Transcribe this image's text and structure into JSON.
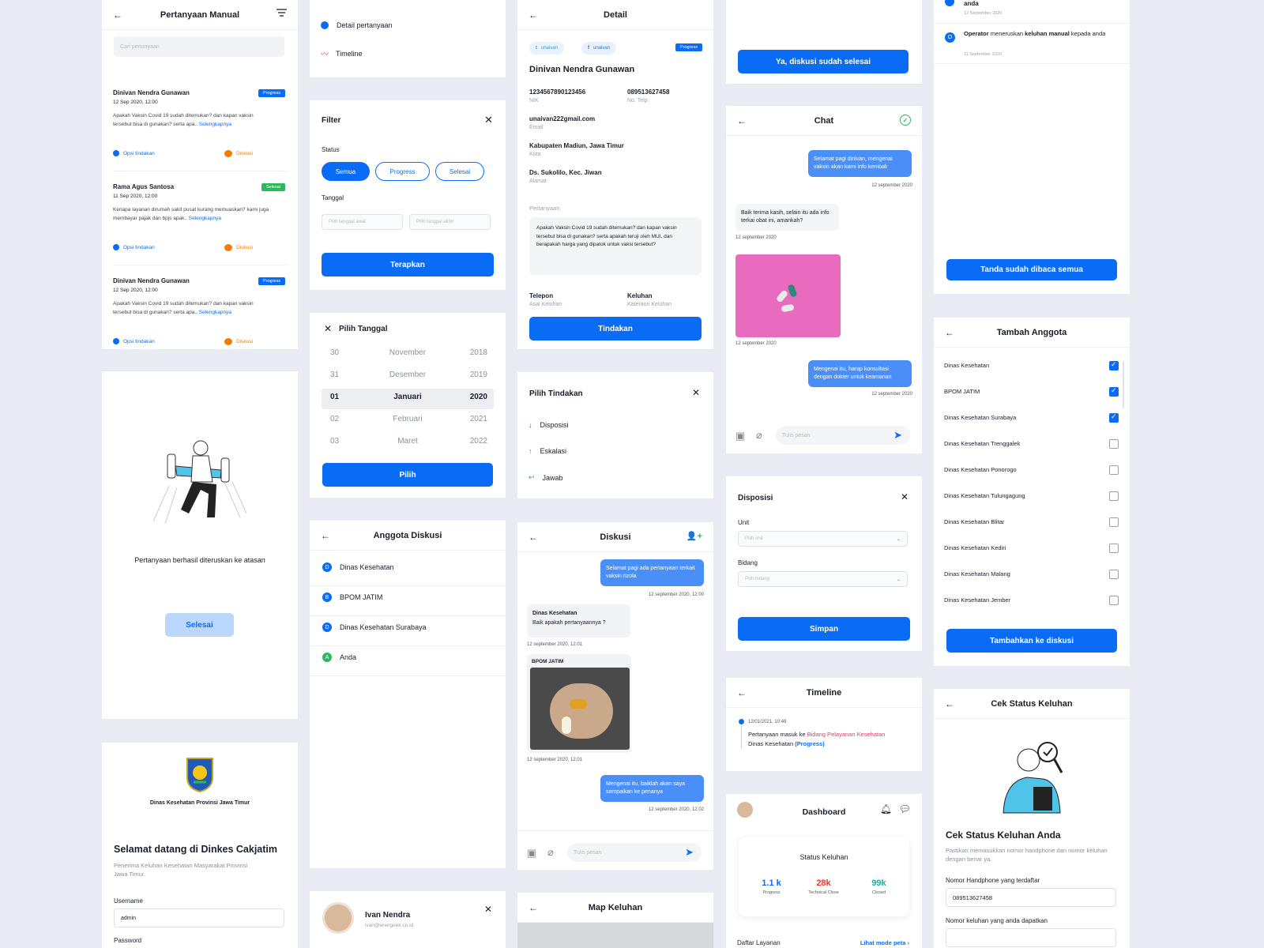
{
  "pertanyaan": {
    "title": "Pertanyaan Manual",
    "search_placeholder": "Cari pertanyaan",
    "items": [
      {
        "name": "Dinivan Nendra Gunawan",
        "date": "12 Sep 2020, 12:00",
        "badge": "Progress",
        "text": "Apakah Vaksin Covid 19 sudah ditemukan? dan kapan vaksin tersebut bisa di gunakan? serta apa..",
        "more": "Selengkapnya",
        "opsi": "Opsi tindakan",
        "diskusi": "Diskusi"
      },
      {
        "name": "Rama Agus Santosa",
        "date": "11 Sep 2020, 12:00",
        "badge": "Selesai",
        "text": "Kenapa layanan dirumah sakit pusat kurang memuaskan? kami juga membayar pajak dan bpjs apak..",
        "more": "Selengkapnya",
        "opsi": "Opsi tindakan",
        "diskusi": "Diskusi"
      },
      {
        "name": "Dinivan Nendra Gunawan",
        "date": "12 Sep 2020, 12:00",
        "badge": "Progress",
        "text": "Apakah Vaksin Covid 19 sudah ditemukan? dan kapan vaksin tersebut bisa di gunakan? serta apa..",
        "more": "Selengkapnya",
        "opsi": "Opsi tindakan",
        "diskusi": "Diskusi"
      }
    ]
  },
  "success": {
    "message": "Pertanyaan berhasil diteruskan ke atasan",
    "button": "Selesai"
  },
  "login": {
    "org": "Dinas Kesehatan Provinsi Jawa Timur",
    "welcome": "Selamat datang di Dinkes Cakjatim",
    "sub": "Penerima Keluhan Kesehatan Masyarakat Provinsi Jawa Timur.",
    "username_label": "Username",
    "username_value": "admin",
    "password_label": "Password"
  },
  "menu": {
    "item1": "Detail pertanyaan",
    "item2": "Timeline"
  },
  "filter": {
    "title": "Filter",
    "status_label": "Status",
    "statuses": [
      "Semua",
      "Progress",
      "Selesai"
    ],
    "tanggal_label": "Tanggal",
    "from_placeholder": "Pilih tanggal awal",
    "to_placeholder": "Pilih tanggal akhir",
    "apply": "Terapkan"
  },
  "picker": {
    "title": "Pilih Tanggal",
    "days": [
      "30",
      "31",
      "01",
      "02",
      "03"
    ],
    "months": [
      "November",
      "Desember",
      "Januari",
      "Februari",
      "Maret"
    ],
    "years": [
      "2018",
      "2019",
      "2020",
      "2021",
      "2022"
    ],
    "button": "Pilih"
  },
  "anggota": {
    "title": "Anggota Diskusi",
    "members": [
      {
        "initial": "D",
        "name": "Dinas Kesehatan",
        "color": "#0a6cf5"
      },
      {
        "initial": "B",
        "name": "BPOM JATIM",
        "color": "#0a6cf5"
      },
      {
        "initial": "D",
        "name": "Dinas Kesehatan Surabaya",
        "color": "#0a6cf5"
      },
      {
        "initial": "A",
        "name": "Anda",
        "color": "#2eb85c"
      }
    ]
  },
  "profile": {
    "name": "Ivan Nendra",
    "email": "ivan@energeek.co.id"
  },
  "detail": {
    "title": "Detail",
    "twitter": "unaivan",
    "facebook": "unaivan",
    "badge": "Progress",
    "name": "Dinivan Nendra Gunawan",
    "nik": "1234567890123456",
    "nik_label": "NIK",
    "phone": "089513627458",
    "phone_label": "No. Telp",
    "email": "unaivan222gmail.com",
    "email_label": "Email",
    "kota": "Kabupaten Madiun, Jawa Timur",
    "kota_label": "Kota",
    "alamat": "Ds. Sukolilo, Kec. Jiwan",
    "alamat_label": "Alamat",
    "q_label": "Pertanyaan",
    "question": "Apakah Vaksin Covid 19 sudah ditemukan? dan kapan vaksin tersebut bisa di gunakan? serta apakah teruji oleh MUI, dan berapakah harga yang dipatok untuk vaksi tersebut?",
    "telepon": "Telepon",
    "asal": "Asal Keluhan",
    "keluhan": "Keluhan",
    "kategori": "Kateraori Keluhan",
    "button": "Tindakan"
  },
  "tindakan": {
    "title": "Pilih Tindakan",
    "items": [
      "Disposisi",
      "Eskalasi",
      "Jawab"
    ]
  },
  "diskusi": {
    "title": "Diskusi",
    "m1": "Selamat pagi ada pertanyaan terkait vaksin rizola",
    "t1": "12 september 2020, 12:00",
    "s2": "Dinas Kesehatan",
    "m2": "Baik apakah pertanyaannya ?",
    "t2": "12 september 2020, 12:01",
    "s3": "BPOM JATIM",
    "t3": "12 september 2020, 12:01",
    "m4": "Mengenai itu, baiklah akan saya sampaikan ke penanya",
    "t4": "12 september 2020, 12:02",
    "input": "Tulis pesan"
  },
  "map": {
    "title": "Map Keluhan"
  },
  "confirm": {
    "button": "Ya, diskusi sudah selesai"
  },
  "chat": {
    "title": "Chat",
    "m1": "Selamat pagi dinivan, mengenai vaksin akan kami info kembali",
    "t1": "12 september 2020",
    "m2": "Baik terima kasih, selain itu ada info terkai obat ini, amankah?",
    "t2": "12 september 2020",
    "t3": "12 september 2020",
    "m4": "Mengenai itu, harap konsultasi dengan dokter untuk keamanan",
    "t4": "12 september 2020",
    "input": "Tulis pesan"
  },
  "disposisi": {
    "title": "Disposisi",
    "unit_label": "Unit",
    "unit_placeholder": "Pilih unit",
    "bidang_label": "Bidang",
    "bidang_placeholder": "Pilih bidang",
    "button": "Simpan"
  },
  "timeline": {
    "title": "Timeline",
    "date": "12/01/2021, 10:49",
    "pre": "Pertanyaan masuk ke ",
    "highlight": "Bidang Pelayanan Kesehatan",
    "org": "Dinas Kesehatan ",
    "status": "(Progress)"
  },
  "dashboard": {
    "title": "Dashboard",
    "status_title": "Status Keluhan",
    "stats": [
      {
        "value": "1.1 k",
        "label": "Progress",
        "color": "#0a6cf5"
      },
      {
        "value": "28k",
        "label": "Technical Close",
        "color": "#e53935"
      },
      {
        "value": "99k",
        "label": "Closed",
        "color": "#18b3a4"
      }
    ],
    "daftar": "Daftar Layanan",
    "lihat": "Lihat mode peta"
  },
  "notif": {
    "n0_text": "anda",
    "n0_date": "12 September 2020",
    "n1_bold": "Operator",
    "n1_pre": " meneruskan ",
    "n1_bold2": "keluhan manual",
    "n1_post": " kepada anda",
    "n1_date": "11 September 2020",
    "button": "Tanda sudah dibaca semua"
  },
  "tambah": {
    "title": "Tambah Anggota",
    "items": [
      {
        "name": "Dinas Kesehatan",
        "checked": true
      },
      {
        "name": "BPOM JATIM",
        "checked": true
      },
      {
        "name": "Dinas Kesehatan Surabaya",
        "checked": true
      },
      {
        "name": "Dinas Kesehatan Trenggalek",
        "checked": false
      },
      {
        "name": "Dinas Kesehatan Ponorogo",
        "checked": false
      },
      {
        "name": "Dinas Kesehatan Tulungagung",
        "checked": false
      },
      {
        "name": "Dinas Kesehatan Blitar",
        "checked": false
      },
      {
        "name": "Dinas Kesehatan Kediri",
        "checked": false
      },
      {
        "name": "Dinas Kesehatan Malang",
        "checked": false
      },
      {
        "name": "Dinas Kesehatan Jember",
        "checked": false
      }
    ],
    "button": "Tambahkan ke diskusi"
  },
  "cek": {
    "title": "Cek Status Keluhan",
    "heading": "Cek Status Keluhan Anda",
    "sub": "Pastikan memasukkan nomor handphone dan nomor keluhan dengan benar ya.",
    "hp_label": "Nomor Handphone yang terdaftar",
    "hp_value": "089513627458",
    "no_label": "Nomor keluhan yang anda dapatkan"
  }
}
